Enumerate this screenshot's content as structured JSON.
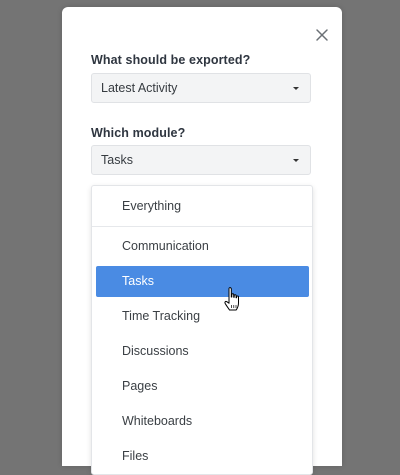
{
  "dialog": {
    "export_label": "What should be exported?",
    "export_value": "Latest Activity",
    "module_label": "Which module?",
    "module_value": "Tasks"
  },
  "dropdown": {
    "options": [
      {
        "label": "Everything"
      },
      {
        "label": "Communication"
      },
      {
        "label": "Tasks"
      },
      {
        "label": "Time Tracking"
      },
      {
        "label": "Discussions"
      },
      {
        "label": "Pages"
      },
      {
        "label": "Whiteboards"
      },
      {
        "label": "Files"
      }
    ],
    "selected": "Tasks"
  },
  "colors": {
    "overlay": "#747474",
    "selected_bg": "#4a8be3",
    "select_bg": "#f3f4f5"
  },
  "icons": {
    "close": "close-icon",
    "caret": "caret-down-icon",
    "cursor": "hand-pointer-cursor"
  }
}
